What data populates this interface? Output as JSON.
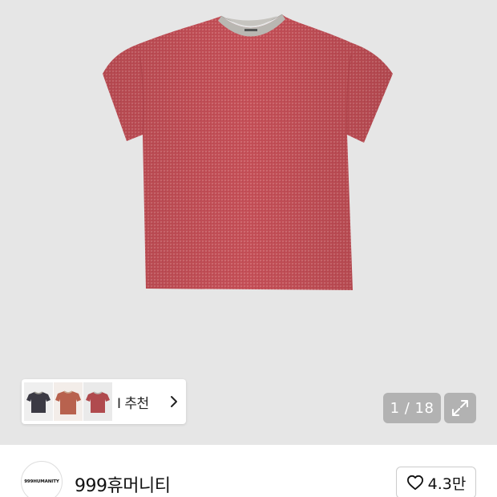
{
  "product": {
    "image_alt": "",
    "shirt_color": "#c0525a",
    "collar_color": "#b9b7b2"
  },
  "ai_recommendation": {
    "label": "I 추천",
    "thumbnails": [
      {
        "color": "#3b3a44",
        "collar": "#9a9890"
      },
      {
        "color": "#b8624e",
        "collar": "#c9a88f"
      },
      {
        "color": "#b04a4e",
        "collar": "#b9b7b2"
      }
    ],
    "chevron_icon": "chevron-right-icon"
  },
  "gallery": {
    "pager_text": "1 / 18",
    "expand_icon": "expand-icon"
  },
  "brand": {
    "logo_text": "999HUMANITY",
    "name": "999휴머니티",
    "like_count": "4.3만",
    "like_icon": "heart-outline-icon"
  }
}
